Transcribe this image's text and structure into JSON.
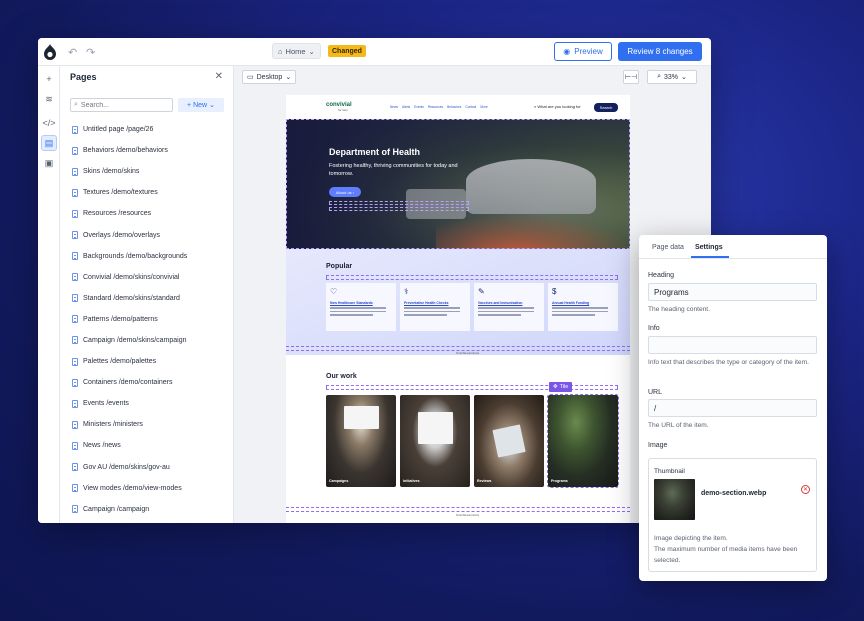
{
  "topbar": {
    "home_label": "Home",
    "changed_badge": "Changed",
    "preview_label": "Preview",
    "review_label": "Review 8 changes"
  },
  "pages": {
    "title": "Pages",
    "search_placeholder": "Search...",
    "new_label": "New",
    "items": [
      "Untitled page /page/26",
      "Behaviors /demo/behaviors",
      "Skins /demo/skins",
      "Textures /demo/textures",
      "Resources /resources",
      "Overlays /demo/overlays",
      "Backgrounds /demo/backgrounds",
      "Convivial /demo/skins/convivial",
      "Standard /demo/skins/standard",
      "Patterns /demo/patterns",
      "Campaign /demo/skins/campaign",
      "Palettes /demo/palettes",
      "Containers /demo/containers",
      "Events /events",
      "Ministers /ministers",
      "News /news",
      "Gov AU /demo/skins/gov-au",
      "View modes /demo/view-modes",
      "Campaign /campaign"
    ]
  },
  "canvas": {
    "device": "Desktop",
    "zoom": "33%"
  },
  "site": {
    "logo": "convivial",
    "logo_sub": "for Gov",
    "nav": [
      "News",
      "Alerts",
      "Events",
      "Resources",
      "Behaviors",
      "Contact",
      "More"
    ],
    "search_placeholder": "What are you looking for",
    "search_button": "Search",
    "hero_title": "Department of Health",
    "hero_sub": "Fostering healthy, thriving communities for today and tomorrow.",
    "hero_button": "About us",
    "popular_title": "Popular",
    "popular_cards": [
      {
        "icon": "♡",
        "title": "New Healthcare Standards"
      },
      {
        "icon": "⚕",
        "title": "Preventative Health Checks"
      },
      {
        "icon": "✎",
        "title": "Vaccines and Immunisation"
      },
      {
        "icon": "$",
        "title": "Annual Health Funding"
      }
    ],
    "section_footer": "Scroll Reveal (Items)",
    "ourwork_title": "Our work",
    "tile_tag": "Tile",
    "tiles": [
      "Campaigns",
      "Initiatives",
      "Reviews",
      "Programs"
    ],
    "ourwork_footer": "Scroll Reveal (Items)"
  },
  "settings": {
    "tab_page_data": "Page data",
    "tab_settings": "Settings",
    "heading_label": "Heading",
    "heading_value": "Programs",
    "heading_help": "The heading content.",
    "info_label": "Info",
    "info_value": "",
    "info_help": "Info text that describes the type or category of the item.",
    "url_label": "URL",
    "url_value": "/",
    "url_help": "The URL of the item.",
    "image_label": "Image",
    "thumbnail_label": "Thumbnail",
    "thumbnail_file": "demo-section.webp",
    "thumbnail_help_1": "Image depicting the item.",
    "thumbnail_help_2": "The maximum number of media items have been selected."
  },
  "colors": {
    "accent": "#2f6ff0",
    "changed": "#f5b91a",
    "tile_tag": "#7a56e8",
    "background": "#1b2585"
  }
}
